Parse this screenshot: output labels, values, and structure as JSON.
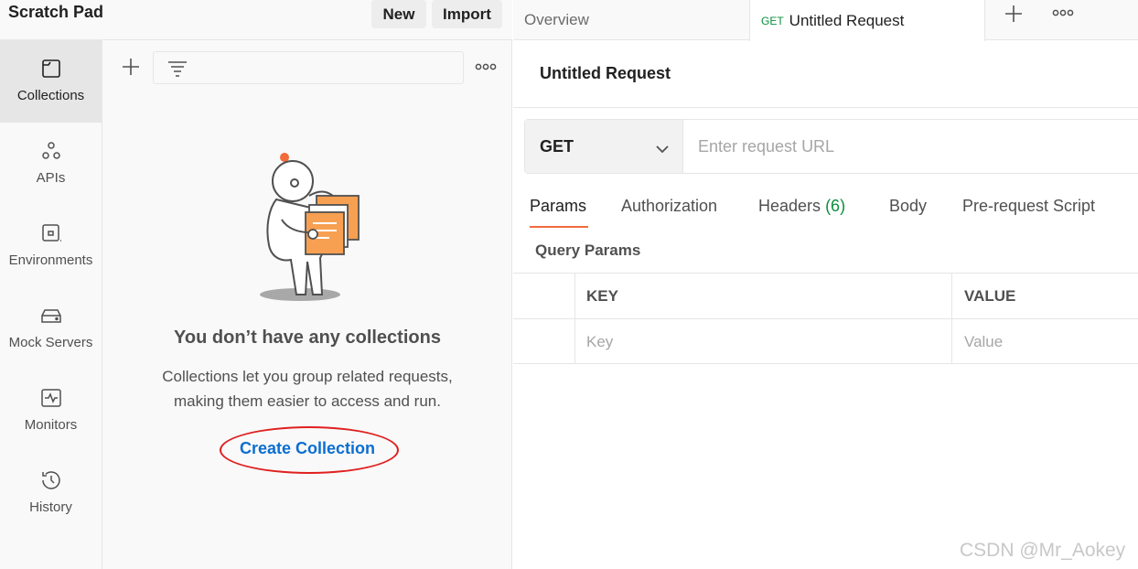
{
  "workspace": {
    "title": "Scratch Pad",
    "new_label": "New",
    "import_label": "Import"
  },
  "sidebar": {
    "items": [
      {
        "label": "Collections",
        "icon": "collections-icon",
        "active": true
      },
      {
        "label": "APIs",
        "icon": "apis-icon"
      },
      {
        "label": "Environments",
        "icon": "environments-icon"
      },
      {
        "label": "Mock Servers",
        "icon": "mock-servers-icon"
      },
      {
        "label": "Monitors",
        "icon": "monitors-icon"
      },
      {
        "label": "History",
        "icon": "history-icon"
      }
    ]
  },
  "collections": {
    "empty_title": "You don’t have any collections",
    "empty_desc_line1": "Collections let you group related requests,",
    "empty_desc_line2": "making them easier to access and run.",
    "create_label": "Create Collection"
  },
  "tabs": {
    "overview_label": "Overview",
    "request_method": "GET",
    "request_label": "Untitled Request"
  },
  "request": {
    "title": "Untitled Request",
    "method": "GET",
    "url_placeholder": "Enter request URL",
    "subtabs": [
      "Params",
      "Authorization",
      "Headers",
      "Body",
      "Pre-request Script"
    ],
    "headers_count": "(6)",
    "section_label": "Query Params",
    "table": {
      "key_header": "KEY",
      "value_header": "VALUE",
      "key_placeholder": "Key",
      "value_placeholder": "Value"
    }
  },
  "watermark": "CSDN @Mr_Aokey",
  "colors": {
    "accent": "#f26b3a",
    "link": "#0b6ed1",
    "method_green": "#0b8f3c",
    "annotation_red": "#e02020"
  }
}
